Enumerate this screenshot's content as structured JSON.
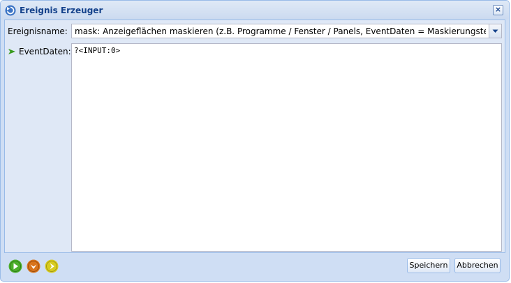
{
  "window": {
    "title": "Ereignis Erzeuger",
    "close_symbol": "×"
  },
  "form": {
    "event_name_label": "Ereignisname:",
    "event_name_value": "mask: Anzeigeflächen maskieren (z.B. Programme / Fenster / Panels, EventDaten = Maskierungstext)",
    "event_data_label": "EventDaten:",
    "event_data_value": "?<INPUT:0>"
  },
  "footer": {
    "icons": [
      "play-green-icon",
      "down-orange-icon",
      "next-yellow-icon"
    ],
    "save_label": "Speichern",
    "cancel_label": "Abbrechen"
  },
  "colors": {
    "title_text": "#15428b",
    "panel_bg": "#dfe8f6",
    "window_bg": "#cfdef4",
    "green": "#4caf2a",
    "orange": "#d9741c",
    "yellow": "#d8cc1e"
  }
}
